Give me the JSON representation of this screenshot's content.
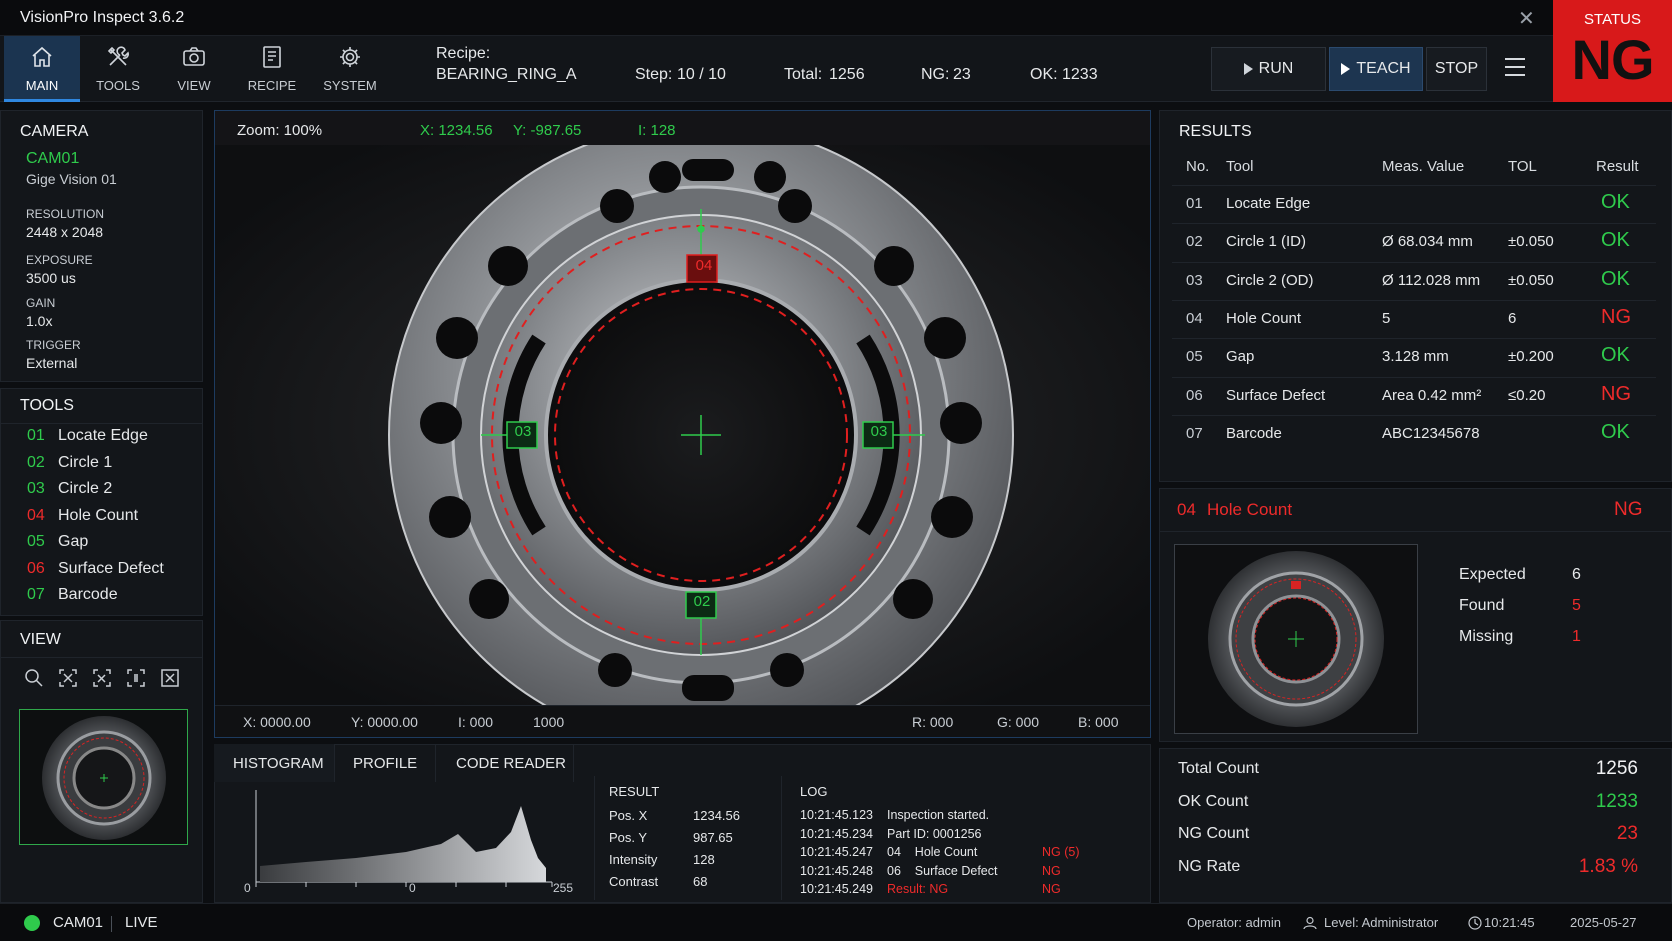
{
  "app": {
    "title": "VisionPro Inspect 3.6.2"
  },
  "nav": [
    {
      "label": "MAIN",
      "icon": "home-icon"
    },
    {
      "label": "TOOLS",
      "icon": "tools-icon"
    },
    {
      "label": "VIEW",
      "icon": "camera-icon"
    },
    {
      "label": "RECIPE",
      "icon": "recipe-icon"
    },
    {
      "label": "SYSTEM",
      "icon": "gear-icon"
    }
  ],
  "recipe": {
    "label": "Recipe:",
    "name": "BEARING_RING_A"
  },
  "counters": {
    "step_label": "Step:",
    "step_value": "10 / 10",
    "total_label": "Total:",
    "total_value": "1256",
    "ng_label": "NG:",
    "ng_value": "23",
    "ok_label": "OK:",
    "ok_value": "1233"
  },
  "actions": {
    "run": "RUN",
    "teach": "TEACH",
    "stop": "STOP"
  },
  "status": {
    "label": "STATUS",
    "value": "NG",
    "color": "#d8191a"
  },
  "camera": {
    "heading": "CAMERA",
    "id": "CAM01",
    "model": "Gige Vision 01",
    "resolution_label": "RESOLUTION",
    "resolution": "2448 x 2048",
    "exposure_label": "EXPOSURE",
    "exposure": "3500 us",
    "gain_label": "GAIN",
    "gain": "1.0x",
    "trigger_label": "TRIGGER",
    "trigger": "External"
  },
  "tools": {
    "heading": "TOOLS",
    "items": [
      {
        "num": "01",
        "name": "Locate Edge",
        "state": "ok"
      },
      {
        "num": "02",
        "name": "Circle 1",
        "state": "ok"
      },
      {
        "num": "03",
        "name": "Circle 2",
        "state": "ok"
      },
      {
        "num": "04",
        "name": "Hole Count",
        "state": "ng"
      },
      {
        "num": "05",
        "name": "Gap",
        "state": "ok"
      },
      {
        "num": "06",
        "name": "Surface Defect",
        "state": "ng"
      },
      {
        "num": "07",
        "name": "Barcode",
        "state": "ok"
      }
    ]
  },
  "view": {
    "heading": "VIEW",
    "icons": [
      "zoom-in-icon",
      "fit-to-window-icon",
      "fit-width-icon",
      "actual-size-icon",
      "fullscreen-icon"
    ]
  },
  "viewer": {
    "zoom": "Zoom: 100%",
    "cursor_x": "X: 1234.56",
    "cursor_y": "Y: -987.65",
    "cursor_i": "I: 128",
    "roi_labels": [
      "04",
      "03",
      "03",
      "02"
    ],
    "footer": {
      "x": "X:  0000.00",
      "y": "Y:  0000.00",
      "i": "I:  000",
      "exposure_val": "1000",
      "r": "R:  000",
      "g": "G:  000",
      "b": "B:  000"
    }
  },
  "analysis_tabs": [
    "HISTOGRAM",
    "PROFILE",
    "CODE READER"
  ],
  "histogram": {
    "x_min": "0",
    "x_mid": "0",
    "x_max": "255"
  },
  "result_box": {
    "heading": "RESULT",
    "rows": [
      {
        "label": "Pos. X",
        "value": "1234.56"
      },
      {
        "label": "Pos. Y",
        "value": "987.65"
      },
      {
        "label": "Intensity",
        "value": "128"
      },
      {
        "label": "Contrast",
        "value": "68"
      }
    ]
  },
  "log": {
    "heading": "LOG",
    "lines": [
      {
        "time": "10:21:45.123",
        "msg": "Inspection started.",
        "flag": ""
      },
      {
        "time": "10:21:45.234",
        "msg": "Part ID: 0001256",
        "flag": ""
      },
      {
        "time": "10:21:45.247",
        "msg": "04    Hole Count",
        "flag": "NG (5)"
      },
      {
        "time": "10:21:45.248",
        "msg": "06    Surface Defect",
        "flag": "NG"
      },
      {
        "time": "10:21:45.249",
        "msg": "Result: NG",
        "flag": "NG"
      }
    ]
  },
  "results": {
    "heading": "RESULTS",
    "columns": [
      "No.",
      "Tool",
      "Meas. Value",
      "TOL",
      "Result"
    ],
    "rows": [
      {
        "no": "01",
        "tool": "Locate Edge",
        "value": "",
        "tol": "",
        "result": "OK"
      },
      {
        "no": "02",
        "tool": "Circle 1 (ID)",
        "value": "Ø 68.034 mm",
        "tol": "±0.050",
        "result": "OK"
      },
      {
        "no": "03",
        "tool": "Circle 2 (OD)",
        "value": "Ø 112.028 mm",
        "tol": "±0.050",
        "result": "OK"
      },
      {
        "no": "04",
        "tool": "Hole Count",
        "value": "5",
        "tol": "6",
        "result": "NG"
      },
      {
        "no": "05",
        "tool": "Gap",
        "value": "3.128 mm",
        "tol": "±0.200",
        "result": "OK"
      },
      {
        "no": "06",
        "tool": "Surface Defect",
        "value": "Area 0.42 mm²",
        "tol": "≤0.20",
        "result": "NG"
      },
      {
        "no": "07",
        "tool": "Barcode",
        "value": "ABC12345678",
        "tol": "",
        "result": "OK"
      }
    ]
  },
  "detail": {
    "title_num": "04",
    "title": "Hole Count",
    "result": "NG",
    "rows": [
      {
        "label": "Expected",
        "value": "6",
        "state": "neutral"
      },
      {
        "label": "Found",
        "value": "5",
        "state": "ng"
      },
      {
        "label": "Missing",
        "value": "1",
        "state": "ng"
      }
    ]
  },
  "stats": [
    {
      "label": "Total Count",
      "value": "1256",
      "state": "neutral"
    },
    {
      "label": "OK Count",
      "value": "1233",
      "state": "ok"
    },
    {
      "label": "NG Count",
      "value": "23",
      "state": "ng"
    },
    {
      "label": "NG Rate",
      "value": "1.83 %",
      "state": "ng"
    }
  ],
  "footer": {
    "camera": "CAM01",
    "mode": "LIVE",
    "operator": "Operator: admin",
    "level": "Level: Administrator",
    "time": "10:21:45",
    "date": "2025-05-27"
  },
  "colors": {
    "ok": "#2fcb4c",
    "ng": "#ee2b2b",
    "accent": "#2f87e0"
  }
}
